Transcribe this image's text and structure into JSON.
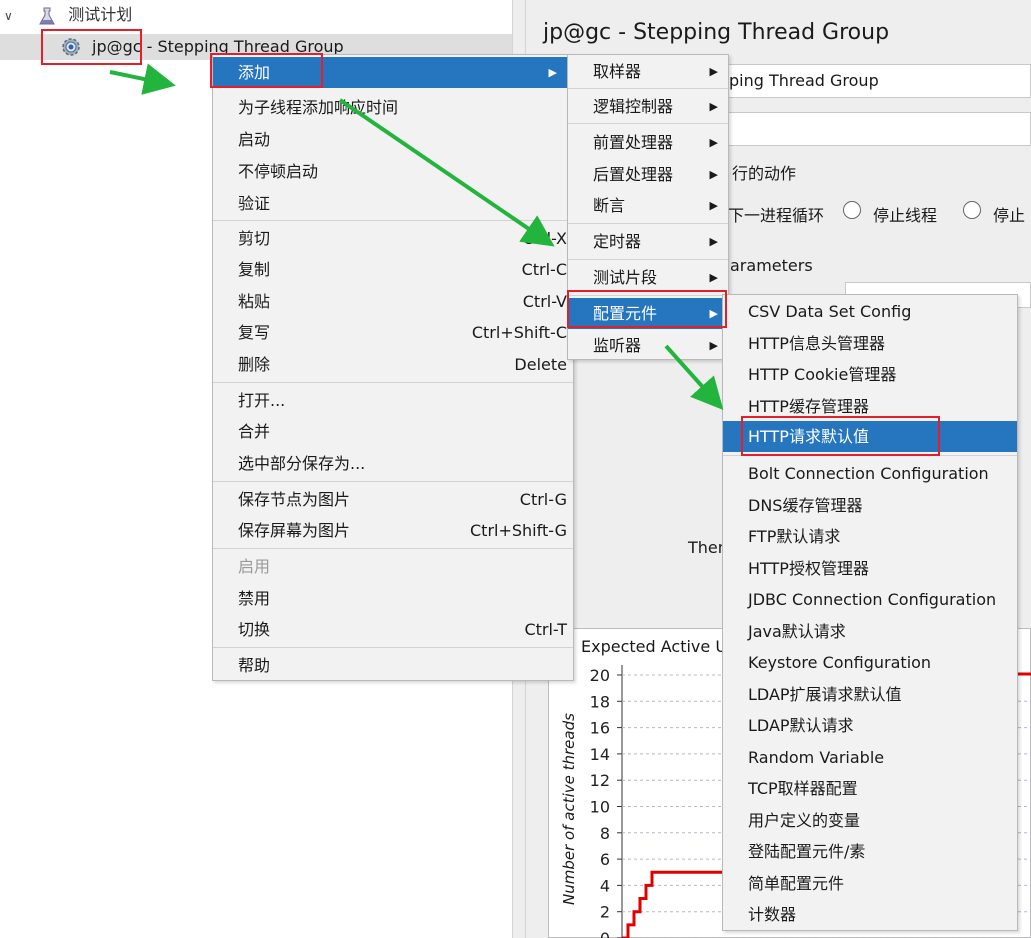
{
  "tree": {
    "root_label": "测试计划",
    "thread_group_label": "jp@gc - Stepping Thread Group"
  },
  "panel": {
    "title": "jp@gc - Stepping Thread Group",
    "name_value": "ping Thread Group",
    "action_label": "行的动作",
    "radio_continue": "下一进程循环",
    "radio_stop_thread": "停止线程",
    "radio_stop_test": "停止",
    "params_label": "arameters",
    "then_label": "Then",
    "chart": {
      "title": "Expected Active U",
      "ylabel": "Number of active threads"
    }
  },
  "context_menu": {
    "items": [
      {
        "label": "添加",
        "submenu": true,
        "highlighted": true
      },
      {
        "label": "为子线程添加响应时间"
      },
      {
        "label": "启动"
      },
      {
        "label": "不停顿启动"
      },
      {
        "label": "验证"
      },
      {
        "label": "剪切",
        "shortcut": "Ctrl-X"
      },
      {
        "label": "复制",
        "shortcut": "Ctrl-C"
      },
      {
        "label": "粘贴",
        "shortcut": "Ctrl-V"
      },
      {
        "label": "复写",
        "shortcut": "Ctrl+Shift-C"
      },
      {
        "label": "删除",
        "shortcut": "Delete"
      },
      {
        "label": "打开..."
      },
      {
        "label": "合并"
      },
      {
        "label": "选中部分保存为..."
      },
      {
        "label": "保存节点为图片",
        "shortcut": "Ctrl-G"
      },
      {
        "label": "保存屏幕为图片",
        "shortcut": "Ctrl+Shift-G"
      },
      {
        "label": "启用",
        "disabled": true
      },
      {
        "label": "禁用"
      },
      {
        "label": "切换",
        "shortcut": "Ctrl-T"
      },
      {
        "label": "帮助"
      }
    ]
  },
  "add_submenu": {
    "items": [
      {
        "label": "取样器"
      },
      {
        "label": "逻辑控制器"
      },
      {
        "label": "前置处理器"
      },
      {
        "label": "后置处理器"
      },
      {
        "label": "断言"
      },
      {
        "label": "定时器"
      },
      {
        "label": "测试片段"
      },
      {
        "label": "配置元件",
        "highlighted": true
      },
      {
        "label": "监听器"
      }
    ]
  },
  "config_submenu": {
    "items": [
      {
        "label": "CSV Data Set Config"
      },
      {
        "label": "HTTP信息头管理器"
      },
      {
        "label": "HTTP Cookie管理器"
      },
      {
        "label": "HTTP缓存管理器"
      },
      {
        "label": "HTTP请求默认值",
        "highlighted": true
      },
      {
        "label": "Bolt Connection Configuration"
      },
      {
        "label": "DNS缓存管理器"
      },
      {
        "label": "FTP默认请求"
      },
      {
        "label": "HTTP授权管理器"
      },
      {
        "label": "JDBC Connection Configuration"
      },
      {
        "label": "Java默认请求"
      },
      {
        "label": "Keystore Configuration"
      },
      {
        "label": "LDAP扩展请求默认值"
      },
      {
        "label": "LDAP默认请求"
      },
      {
        "label": "Random Variable"
      },
      {
        "label": "TCP取样器配置"
      },
      {
        "label": "用户定义的变量"
      },
      {
        "label": "登陆配置元件/素"
      },
      {
        "label": "简单配置元件"
      },
      {
        "label": "计数器"
      }
    ]
  },
  "chart_data": {
    "type": "line",
    "title": "Expected Active U",
    "ylabel": "Number of active threads",
    "yticks": [
      0,
      2,
      4,
      6,
      8,
      10,
      12,
      14,
      16,
      18,
      20
    ],
    "ylim": [
      0,
      20
    ],
    "series": [
      {
        "values": [
          0,
          1,
          2,
          3,
          4,
          5,
          5,
          5,
          5,
          5
        ]
      }
    ]
  },
  "colors": {
    "highlight": "#2675bf",
    "annotation_box": "#e3202a",
    "arrow": "#22b43c",
    "chart_line": "#e00000"
  }
}
